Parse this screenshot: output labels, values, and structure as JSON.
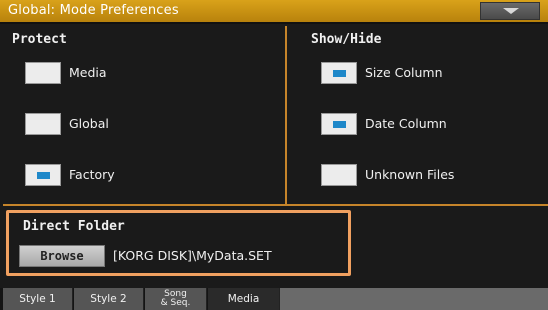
{
  "window": {
    "title": "Global: Mode Preferences",
    "menu_icon": "triangle-down-icon"
  },
  "protect": {
    "title": "Protect",
    "items": [
      {
        "label": "Media",
        "checked": false
      },
      {
        "label": "Global",
        "checked": false
      },
      {
        "label": "Factory",
        "checked": true
      }
    ]
  },
  "show_hide": {
    "title": "Show/Hide",
    "items": [
      {
        "label": "Size Column",
        "checked": true
      },
      {
        "label": "Date Column",
        "checked": true
      },
      {
        "label": "Unknown Files",
        "checked": false
      }
    ]
  },
  "direct_folder": {
    "title": "Direct Folder",
    "browse_label": "Browse",
    "path": "[KORG DISK]\\MyData.SET"
  },
  "tabs": [
    {
      "label": "Style 1",
      "active": false
    },
    {
      "label": "Style 2",
      "active": false
    },
    {
      "label_line1": "Song",
      "label_line2": "& Seq.",
      "active": false
    },
    {
      "label": "Media",
      "active": true
    }
  ],
  "colors": {
    "title_bar": "#c8920f",
    "section_border": "#c5842a",
    "highlight_border": "#f0a060",
    "checkbox_mark": "#1f88c9"
  }
}
